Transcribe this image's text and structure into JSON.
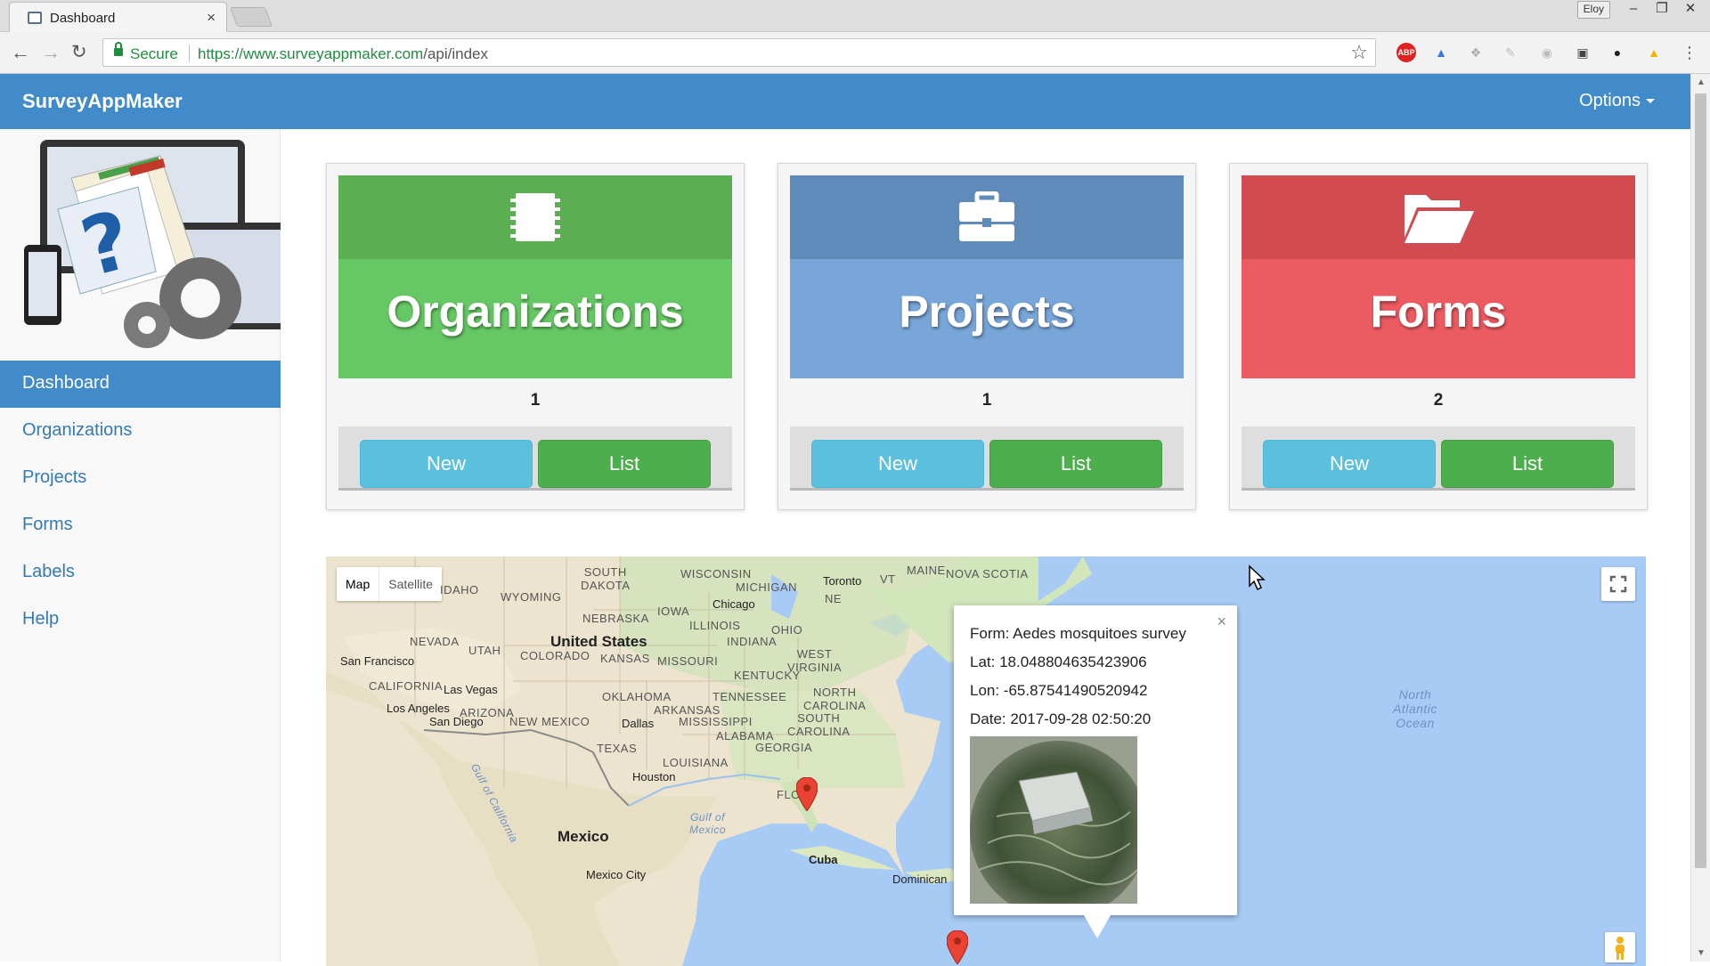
{
  "browser": {
    "tab_title": "Dashboard",
    "tab_close": "×",
    "profile": "Eloy",
    "window_buttons": [
      "–",
      "❐",
      "✕"
    ],
    "secure_label": "Secure",
    "url_host": "https://www.surveyappmaker.com",
    "url_path": "/api/index",
    "nav_icons": [
      "back-icon",
      "forward-icon",
      "reload-icon"
    ],
    "extension_icons": [
      "adblock-icon",
      "graduation-cap-icon",
      "dropbox-icon",
      "note-icon",
      "shield-icon",
      "cast-icon",
      "app-icon",
      "drive-icon",
      "menu-icon"
    ]
  },
  "appbar": {
    "brand": "SurveyAppMaker",
    "options_label": "Options"
  },
  "sidebar": {
    "items": [
      {
        "label": "Dashboard",
        "active": true
      },
      {
        "label": "Organizations"
      },
      {
        "label": "Projects"
      },
      {
        "label": "Forms"
      },
      {
        "label": "Labels"
      },
      {
        "label": "Help"
      }
    ]
  },
  "cards": [
    {
      "title": "Organizations",
      "count": "1",
      "new_label": "New",
      "list_label": "List",
      "icon": "book-icon",
      "color": "#5cae52"
    },
    {
      "title": "Projects",
      "count": "1",
      "new_label": "New",
      "list_label": "List",
      "icon": "briefcase-icon",
      "color": "#5f8bbb"
    },
    {
      "title": "Forms",
      "count": "2",
      "new_label": "New",
      "list_label": "List",
      "icon": "folder-open-icon",
      "color": "#d24b50"
    }
  ],
  "map": {
    "type_buttons": [
      "Map",
      "Satellite"
    ],
    "labels": {
      "south_dakota": "SOUTH\nDAKOTA",
      "wisconsin": "WISCONSIN",
      "michigan": "MICHIGAN",
      "toronto": "Toronto",
      "vt": "VT",
      "maine": "MAINE",
      "nova_scotia": "NOVA SCOTIA",
      "idaho": "IDAHO",
      "wyoming": "WYOMING",
      "chicago": "Chicago",
      "iowa": "IOWA",
      "nebraska": "NEBRASKA",
      "illinois": "ILLINOIS",
      "ohio": "OHIO",
      "nevada": "NEVADA",
      "utah": "UTAH",
      "united_states": "United States",
      "indiana": "INDIANA",
      "colorado": "COLORADO",
      "kansas": "KANSAS",
      "missouri": "MISSOURI",
      "west_virginia": "WEST\nVIRGINIA",
      "san_francisco": "San Francisco",
      "kentucky": "KENTUCKY",
      "california": "CALIFORNIA",
      "las_vegas": "Las Vegas",
      "oklahoma": "OKLAHOMA",
      "tennessee": "TENNESSEE",
      "north_carolina": "NORTH\nCAROLINA",
      "los_angeles": "Los Angeles",
      "arizona": "ARIZONA",
      "arkansas": "ARKANSAS",
      "san_diego": "San Diego",
      "new_mexico": "NEW MEXICO",
      "dallas": "Dallas",
      "mississippi": "MISSISSIPPI",
      "south_carolina": "SOUTH\nCAROLINA",
      "alabama": "ALABAMA",
      "texas": "TEXAS",
      "georgia": "GEORGIA",
      "louisiana": "LOUISIANA",
      "houston": "Houston",
      "gulf_of_california": "Gulf of California",
      "gulf_of_mexico": "Gulf of\nMexico",
      "florida": "FLO",
      "mexico": "Mexico",
      "cuba": "Cuba",
      "mexico_city": "Mexico City",
      "dominican": "Dominican",
      "north_atlantic": "North\nAtlantic\nOcean",
      "new_york_partial": "NE"
    },
    "infowindow": {
      "form": "Form: Aedes mosquitoes survey",
      "lat": "Lat: 18.048804635423906",
      "lon": "Lon: -65.87541490520942",
      "date": "Date: 2017-09-28 02:50:20",
      "close": "×"
    }
  }
}
